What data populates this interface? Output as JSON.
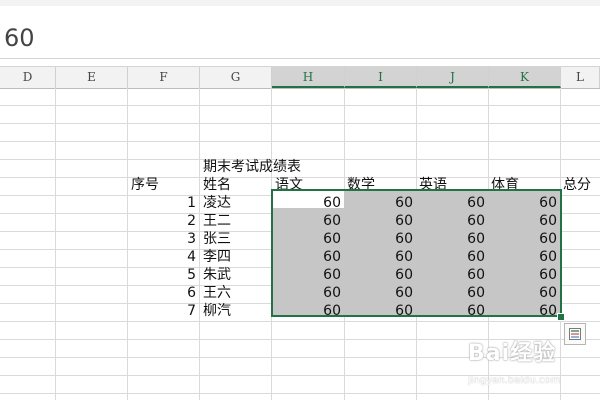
{
  "formula_bar": {
    "value": "60"
  },
  "columns": [
    "D",
    "E",
    "F",
    "G",
    "H",
    "I",
    "J",
    "K",
    "L"
  ],
  "selected_columns": [
    "H",
    "I",
    "J",
    "K"
  ],
  "table": {
    "title": "期末考试成绩表",
    "headers": {
      "index": "序号",
      "name": "姓名",
      "subjects": [
        "语文",
        "数学",
        "英语",
        "体育"
      ],
      "total": "总分"
    },
    "rows": [
      {
        "index": "1",
        "name": "凌达",
        "scores": [
          "60",
          "60",
          "60",
          "60"
        ]
      },
      {
        "index": "2",
        "name": "王二",
        "scores": [
          "60",
          "60",
          "60",
          "60"
        ]
      },
      {
        "index": "3",
        "name": "张三",
        "scores": [
          "60",
          "60",
          "60",
          "60"
        ]
      },
      {
        "index": "4",
        "name": "李四",
        "scores": [
          "60",
          "60",
          "60",
          "60"
        ]
      },
      {
        "index": "5",
        "name": "朱武",
        "scores": [
          "60",
          "60",
          "60",
          "60"
        ]
      },
      {
        "index": "6",
        "name": "王六",
        "scores": [
          "60",
          "60",
          "60",
          "60"
        ]
      },
      {
        "index": "7",
        "name": "柳汽",
        "scores": [
          "60",
          "60",
          "60",
          "60"
        ]
      }
    ]
  },
  "watermark": {
    "brand": "Bai经验",
    "url": "jingyan.baidu.com"
  },
  "colors": {
    "accent": "#217346",
    "selection_fill": "#c6c6c6",
    "gridline": "#dadada"
  }
}
